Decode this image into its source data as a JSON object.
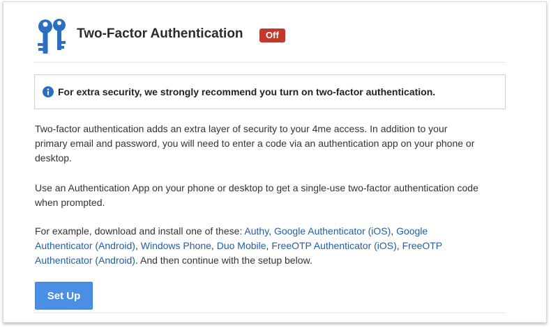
{
  "header": {
    "title": "Two-Factor Authentication",
    "status_badge": "Off",
    "icon": "keys-icon"
  },
  "notice": {
    "icon": "info-icon",
    "text": "For extra security, we strongly recommend you turn on two-factor authentication."
  },
  "description": {
    "paragraph1": "Two-factor authentication adds an extra layer of security to your 4me access. In addition to your primary email and password, you will need to enter a code via an authentication app on your phone or desktop.",
    "paragraph2": "Use an Authentication App on your phone or desktop to get a single-use two-factor authentication code when prompted.",
    "paragraph3_prefix": "For example, download and install one of these: ",
    "apps": [
      "Authy",
      "Google Authenticator (iOS)",
      "Google Authenticator (Android)",
      "Windows Phone",
      "Duo Mobile",
      "FreeOTP Authenticator (iOS)",
      "FreeOTP Authenticator (Android)"
    ],
    "separator": ", ",
    "paragraph3_suffix": ". And then continue with the setup below."
  },
  "actions": {
    "setup_label": "Set Up"
  },
  "colors": {
    "accent": "#2a6fc0",
    "badge_off": "#c0392b",
    "button": "#4a8ee6",
    "link": "#1f5ea8"
  }
}
